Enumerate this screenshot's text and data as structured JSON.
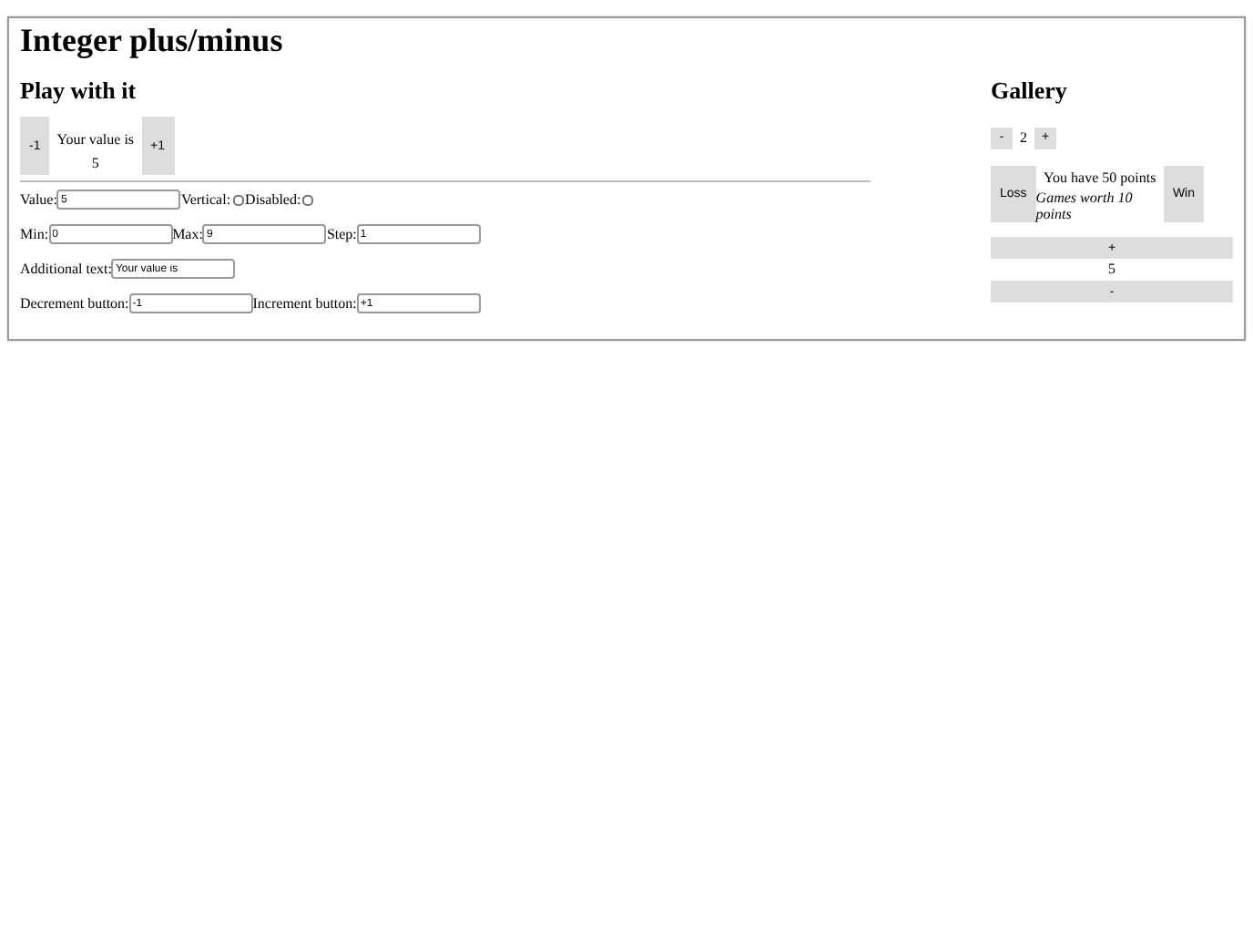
{
  "title": "Integer plus/minus",
  "play": {
    "heading": "Play with it",
    "widget": {
      "decrement": "-1",
      "text": "Your value is",
      "value": "5",
      "increment": "+1"
    },
    "form_rows": [
      [
        {
          "kind": "text",
          "label": "Value:",
          "value": "5"
        },
        {
          "kind": "checkbox",
          "label": "Vertical:",
          "checked": false
        },
        {
          "kind": "checkbox",
          "label": "Disabled:",
          "checked": false
        }
      ],
      [
        {
          "kind": "text",
          "label": "Min:",
          "value": "0"
        },
        {
          "kind": "text",
          "label": "Max:",
          "value": "9"
        },
        {
          "kind": "text",
          "label": "Step:",
          "value": "1"
        }
      ],
      [
        {
          "kind": "text",
          "label": "Additional text:",
          "value": "Your value is"
        }
      ],
      [
        {
          "kind": "text",
          "label": "Decrement button:",
          "value": "-1"
        },
        {
          "kind": "text",
          "label": "Increment button:",
          "value": "+1"
        }
      ]
    ]
  },
  "gallery": {
    "heading": "Gallery",
    "widgets": [
      {
        "kind": "compact",
        "decrement": "-",
        "value": "2",
        "increment": "+"
      },
      {
        "kind": "horizontal",
        "decrement": "Loss",
        "text": "You have 50 points",
        "note": "Games worth 10 points",
        "increment": "Win"
      },
      {
        "kind": "vertical",
        "increment": "+",
        "value": "5",
        "decrement": "-"
      }
    ]
  }
}
